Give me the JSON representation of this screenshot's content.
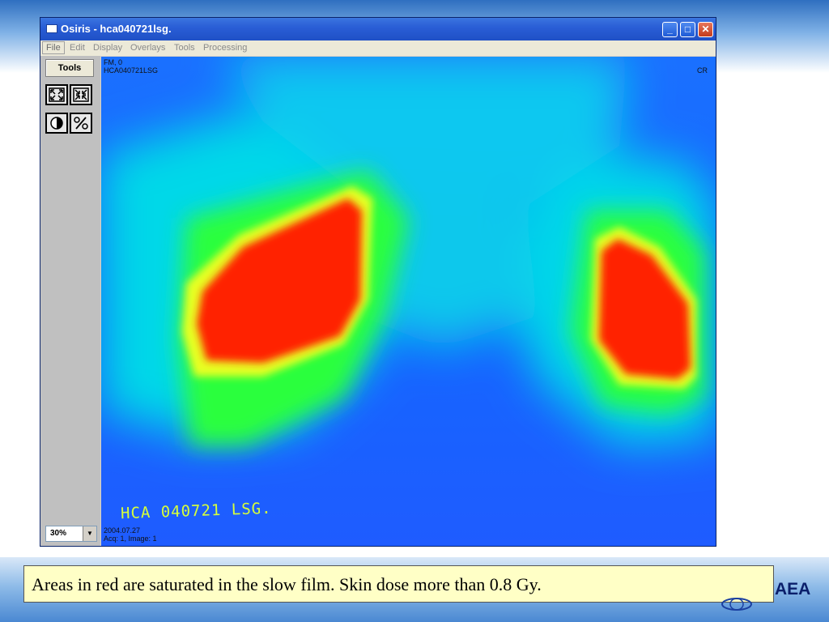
{
  "window": {
    "title": "Osiris - hca040721lsg.",
    "controls": {
      "minimize": "_",
      "maximize": "□",
      "close": "✕"
    }
  },
  "menu": [
    "File",
    "Edit",
    "Display",
    "Overlays",
    "Tools",
    "Processing"
  ],
  "toolpanel": {
    "tools_label": "Tools",
    "buttons": [
      "zoom-fit-icon",
      "zoom-actual-icon",
      "contrast-icon",
      "percent-icon"
    ],
    "zoom": {
      "value": "30%"
    }
  },
  "image": {
    "top_left_line1": "FM, 0",
    "top_left_line2": "HCA040721LSG",
    "top_right": "CR",
    "handwritten_label": "HCA 040721 LSG.",
    "bottom_line1": "2004.07.27",
    "bottom_line2": "Acq: 1, Image: 1"
  },
  "caption": {
    "text": "Areas in red are saturated in the slow film. Skin dose more than 0.8 Gy."
  },
  "logo": {
    "text": "AEA"
  },
  "colors": {
    "dose_low": "#1f5cff",
    "dose_mid": "#00e5e5",
    "dose_high": "#33ff33",
    "dose_saturated": "#ff1a00"
  }
}
